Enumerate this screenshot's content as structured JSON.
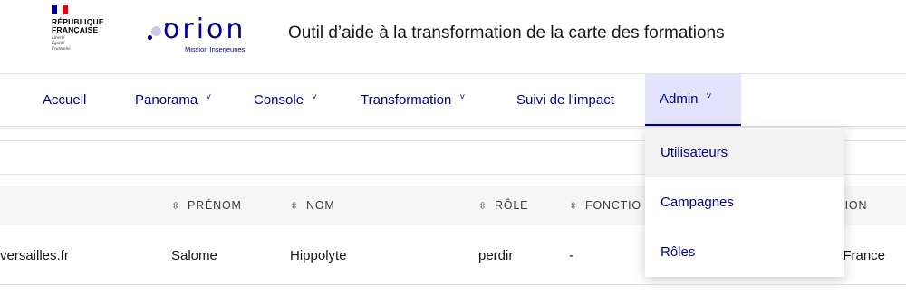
{
  "header": {
    "marianne": {
      "line1": "RÉPUBLIQUE",
      "line2": "FRANÇAISE",
      "devise": [
        "Liberté",
        "Égalité",
        "Fraternité"
      ]
    },
    "logo": {
      "word": "orion",
      "subtitle": "Mission Inserjeunes"
    },
    "title": "Outil d’aide à la transformation de la carte des formations"
  },
  "nav": {
    "items": [
      {
        "label": "Accueil",
        "chevron": ""
      },
      {
        "label": "Panorama",
        "chevron": "˅"
      },
      {
        "label": "Console",
        "chevron": "˅"
      },
      {
        "label": "Transformation",
        "chevron": "˅"
      },
      {
        "label": "Suivi de l'impact",
        "chevron": ""
      },
      {
        "label": "Admin",
        "chevron": "˅"
      }
    ],
    "active": "Admin"
  },
  "dropdown": {
    "items": [
      "Utilisateurs",
      "Campagnes",
      "Rôles"
    ],
    "hovered": "Utilisateurs"
  },
  "table": {
    "sort_icon": "⇳",
    "columns": [
      "PRÉNOM",
      "NOM",
      "RÔLE",
      "FONCTIO",
      "ÉGION"
    ],
    "rows": [
      {
        "email": "versailles.fr",
        "prenom": "Salome",
        "nom": "Hippolyte",
        "role": "perdir",
        "fonction": "-",
        "region": "e-France"
      }
    ]
  },
  "colors": {
    "brand_blue": "#000091",
    "active_tab_bg": "#e3e3fd",
    "flag_red": "#e1000f"
  }
}
